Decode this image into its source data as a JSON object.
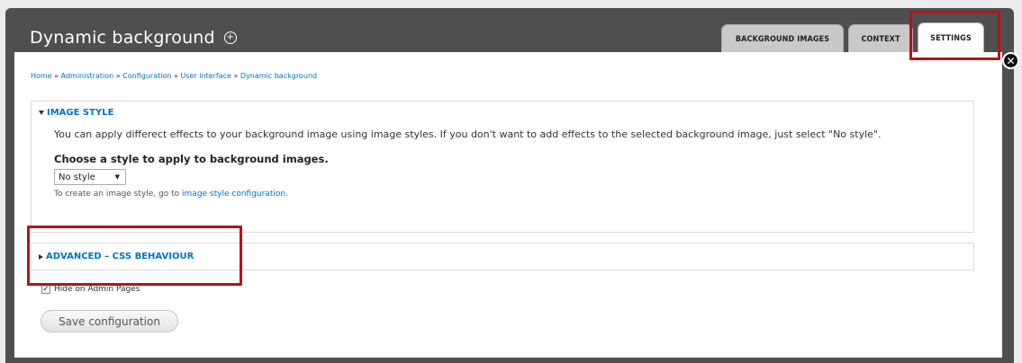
{
  "window": {
    "title": "Dynamic background"
  },
  "tabs": [
    {
      "label": "BACKGROUND IMAGES",
      "active": false
    },
    {
      "label": "CONTEXT",
      "active": false
    },
    {
      "label": "SETTINGS",
      "active": true
    }
  ],
  "breadcrumb": [
    "Home",
    "Administration",
    "Configuration",
    "User interface",
    "Dynamic background"
  ],
  "breadcrumb_separator": "»",
  "image_style": {
    "legend": "IMAGE STYLE",
    "description": "You can apply differect effects to your background image using image styles. If you don't want to add effects to the selected background image, just select \"No style\".",
    "select_label": "Choose a style to apply to background images.",
    "select_value": "No style",
    "help_prefix": "To create an image style, go to ",
    "help_link": "image style configuration",
    "help_suffix": "."
  },
  "advanced": {
    "legend": "ADVANCED – CSS BEHAVIOUR"
  },
  "hide_admin": {
    "label": "Hide on Admin Pages",
    "checked": true
  },
  "save_button": "Save configuration",
  "colors": {
    "link": "#0074bd",
    "highlight": "#b3131a",
    "overlay": "#4f4f4f"
  }
}
